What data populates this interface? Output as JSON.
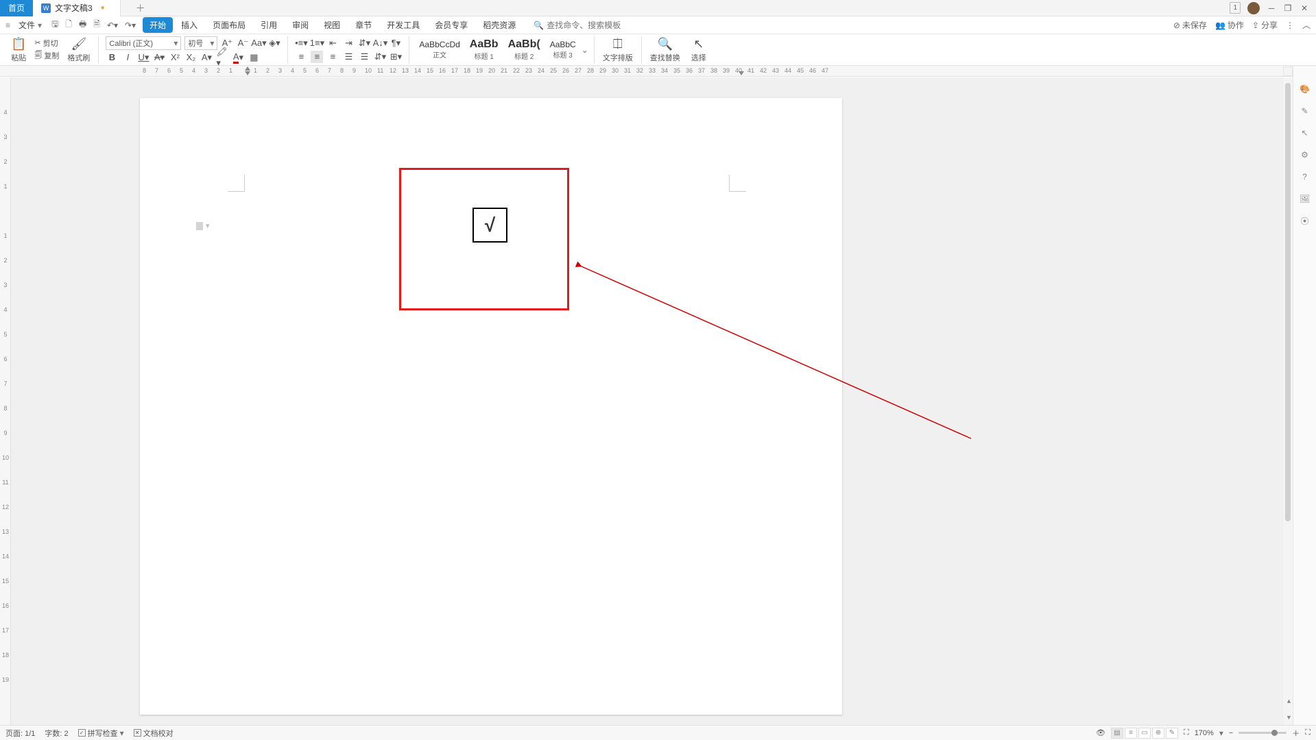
{
  "tabs": {
    "home": "首页",
    "doc": "文字文稿3",
    "docIconLetter": "W"
  },
  "window": {
    "badge": "1"
  },
  "menu": {
    "file": "文件",
    "items": [
      "开始",
      "插入",
      "页面布局",
      "引用",
      "审阅",
      "视图",
      "章节",
      "开发工具",
      "会员专享",
      "稻壳资源"
    ],
    "searchPlaceholder": "查找命令、搜索模板"
  },
  "rightMenu": {
    "unsaved": "未保存",
    "collab": "协作",
    "share": "分享"
  },
  "ribbon": {
    "paste": "粘贴",
    "cut": "剪切",
    "copy": "复制",
    "formatPainter": "格式刷",
    "fontName": "Calibri (正文)",
    "fontSize": "初号",
    "styles": [
      {
        "preview": "AaBbCcDd",
        "label": "正文"
      },
      {
        "preview": "AaBb",
        "label": "标题 1"
      },
      {
        "preview": "AaBb(",
        "label": "标题 2"
      },
      {
        "preview": "AaBbC",
        "label": "标题 3"
      }
    ],
    "textLayout": "文字排版",
    "findReplace": "查找替换",
    "select": "选择"
  },
  "rulerH": [
    "8",
    "7",
    "6",
    "5",
    "4",
    "3",
    "2",
    "1",
    "",
    "1",
    "2",
    "3",
    "4",
    "5",
    "6",
    "7",
    "8",
    "9",
    "10",
    "11",
    "12",
    "13",
    "14",
    "15",
    "16",
    "17",
    "18",
    "19",
    "20",
    "21",
    "22",
    "23",
    "24",
    "25",
    "26",
    "27",
    "28",
    "29",
    "30",
    "31",
    "32",
    "33",
    "34",
    "35",
    "36",
    "37",
    "38",
    "39",
    "40",
    "41",
    "42",
    "43",
    "44",
    "45",
    "46",
    "47"
  ],
  "rulerV": [
    "4",
    "3",
    "2",
    "1",
    "",
    "1",
    "2",
    "3",
    "4",
    "5",
    "6",
    "7",
    "8",
    "9",
    "10",
    "11",
    "12",
    "13",
    "14",
    "15",
    "16",
    "17",
    "18",
    "19"
  ],
  "content": {
    "sqrtSymbol": "√"
  },
  "status": {
    "page": "页面: 1/1",
    "words": "字数: 2",
    "spellCheck": "拼写检查",
    "docProof": "文档校对",
    "zoom": "170%"
  }
}
